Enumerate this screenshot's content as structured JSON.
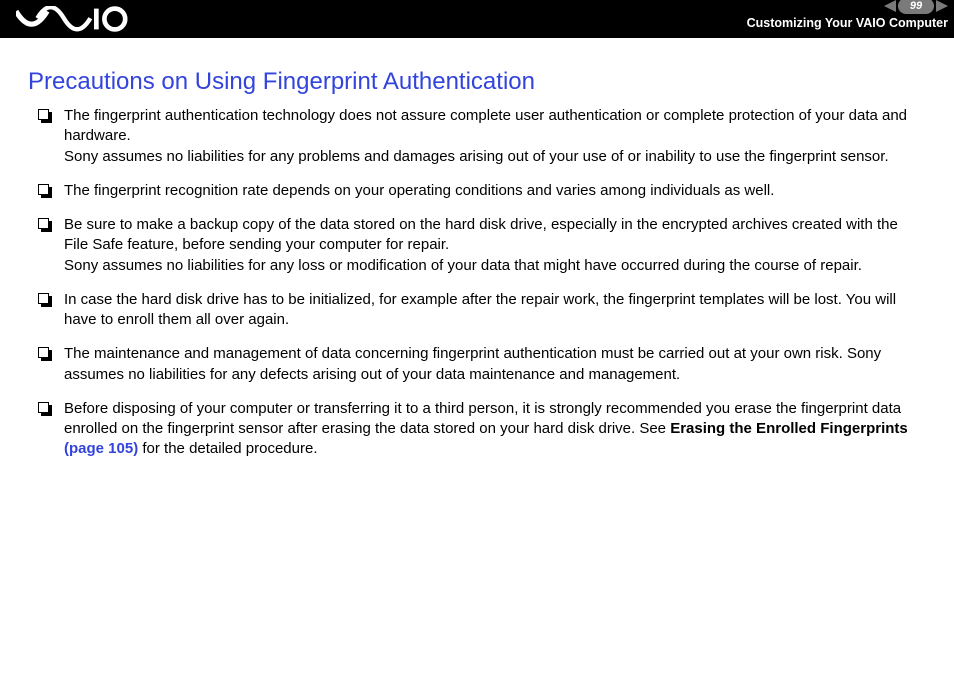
{
  "header": {
    "page_number": "99",
    "section": "Customizing Your VAIO Computer"
  },
  "title": "Precautions on Using Fingerprint Authentication",
  "bullets": [
    {
      "p1": "The fingerprint authentication technology does not assure complete user authentication or complete protection of your data and hardware.",
      "p2": "Sony assumes no liabilities for any problems and damages arising out of your use of or inability to use the fingerprint sensor."
    },
    {
      "p1": "The fingerprint recognition rate depends on your operating conditions and varies among individuals as well."
    },
    {
      "p1": "Be sure to make a backup copy of the data stored on the hard disk drive, especially in the encrypted archives created with the File Safe feature, before sending your computer for repair.",
      "p2": "Sony assumes no liabilities for any loss or modification of your data that might have occurred during the course of repair."
    },
    {
      "p1": "In case the hard disk drive has to be initialized, for example after the repair work, the fingerprint templates will be lost. You will have to enroll them all over again."
    },
    {
      "p1": "The maintenance and management of data concerning fingerprint authentication must be carried out at your own risk. Sony assumes no liabilities for any defects arising out of your data maintenance and management."
    },
    {
      "p1_a": "Before disposing of your computer or transferring it to a third person, it is strongly recommended you erase the fingerprint data enrolled on the fingerprint sensor after erasing the data stored on your hard disk drive. See ",
      "bold": "Erasing the Enrolled Fingerprints",
      "link": " (page 105)",
      "p1_b": " for the detailed procedure."
    }
  ]
}
